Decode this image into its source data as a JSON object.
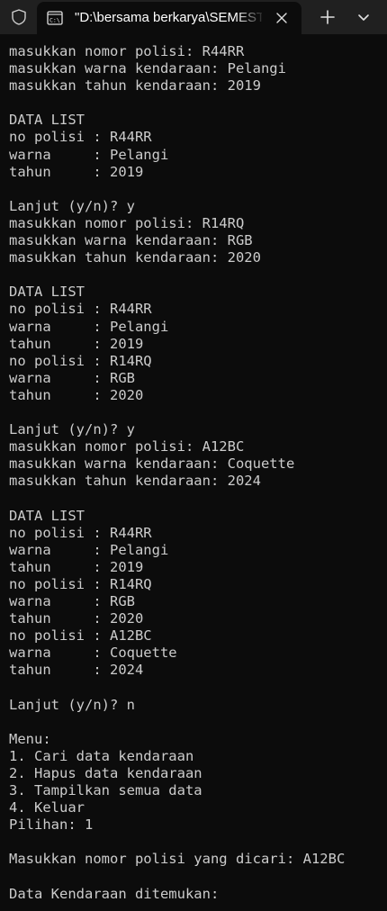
{
  "window": {
    "tab_title": "\"D:\\bersama berkarya\\SEMESTER",
    "tab_icon": "terminal-icon",
    "shield_icon": "shield-icon",
    "close_icon": "close-icon",
    "new_tab_icon": "plus-icon",
    "dropdown_icon": "chevron-down-icon"
  },
  "terminal": {
    "lines": [
      "masukkan nomor polisi: R44RR",
      "masukkan warna kendaraan: Pelangi",
      "masukkan tahun kendaraan: 2019",
      "",
      "DATA LIST",
      "no polisi : R44RR",
      "warna     : Pelangi",
      "tahun     : 2019",
      "",
      "Lanjut (y/n)? y",
      "masukkan nomor polisi: R14RQ",
      "masukkan warna kendaraan: RGB",
      "masukkan tahun kendaraan: 2020",
      "",
      "DATA LIST",
      "no polisi : R44RR",
      "warna     : Pelangi",
      "tahun     : 2019",
      "no polisi : R14RQ",
      "warna     : RGB",
      "tahun     : 2020",
      "",
      "Lanjut (y/n)? y",
      "masukkan nomor polisi: A12BC",
      "masukkan warna kendaraan: Coquette",
      "masukkan tahun kendaraan: 2024",
      "",
      "DATA LIST",
      "no polisi : R44RR",
      "warna     : Pelangi",
      "tahun     : 2019",
      "no polisi : R14RQ",
      "warna     : RGB",
      "tahun     : 2020",
      "no polisi : A12BC",
      "warna     : Coquette",
      "tahun     : 2024",
      "",
      "Lanjut (y/n)? n",
      "",
      "Menu:",
      "1. Cari data kendaraan",
      "2. Hapus data kendaraan",
      "3. Tampilkan semua data",
      "4. Keluar",
      "Pilihan: 1",
      "",
      "Masukkan nomor polisi yang dicari: A12BC",
      "",
      "Data Kendaraan ditemukan:"
    ]
  },
  "colors": {
    "background": "#0c0c0c",
    "titlebar": "#202020",
    "text": "#cccccc"
  }
}
